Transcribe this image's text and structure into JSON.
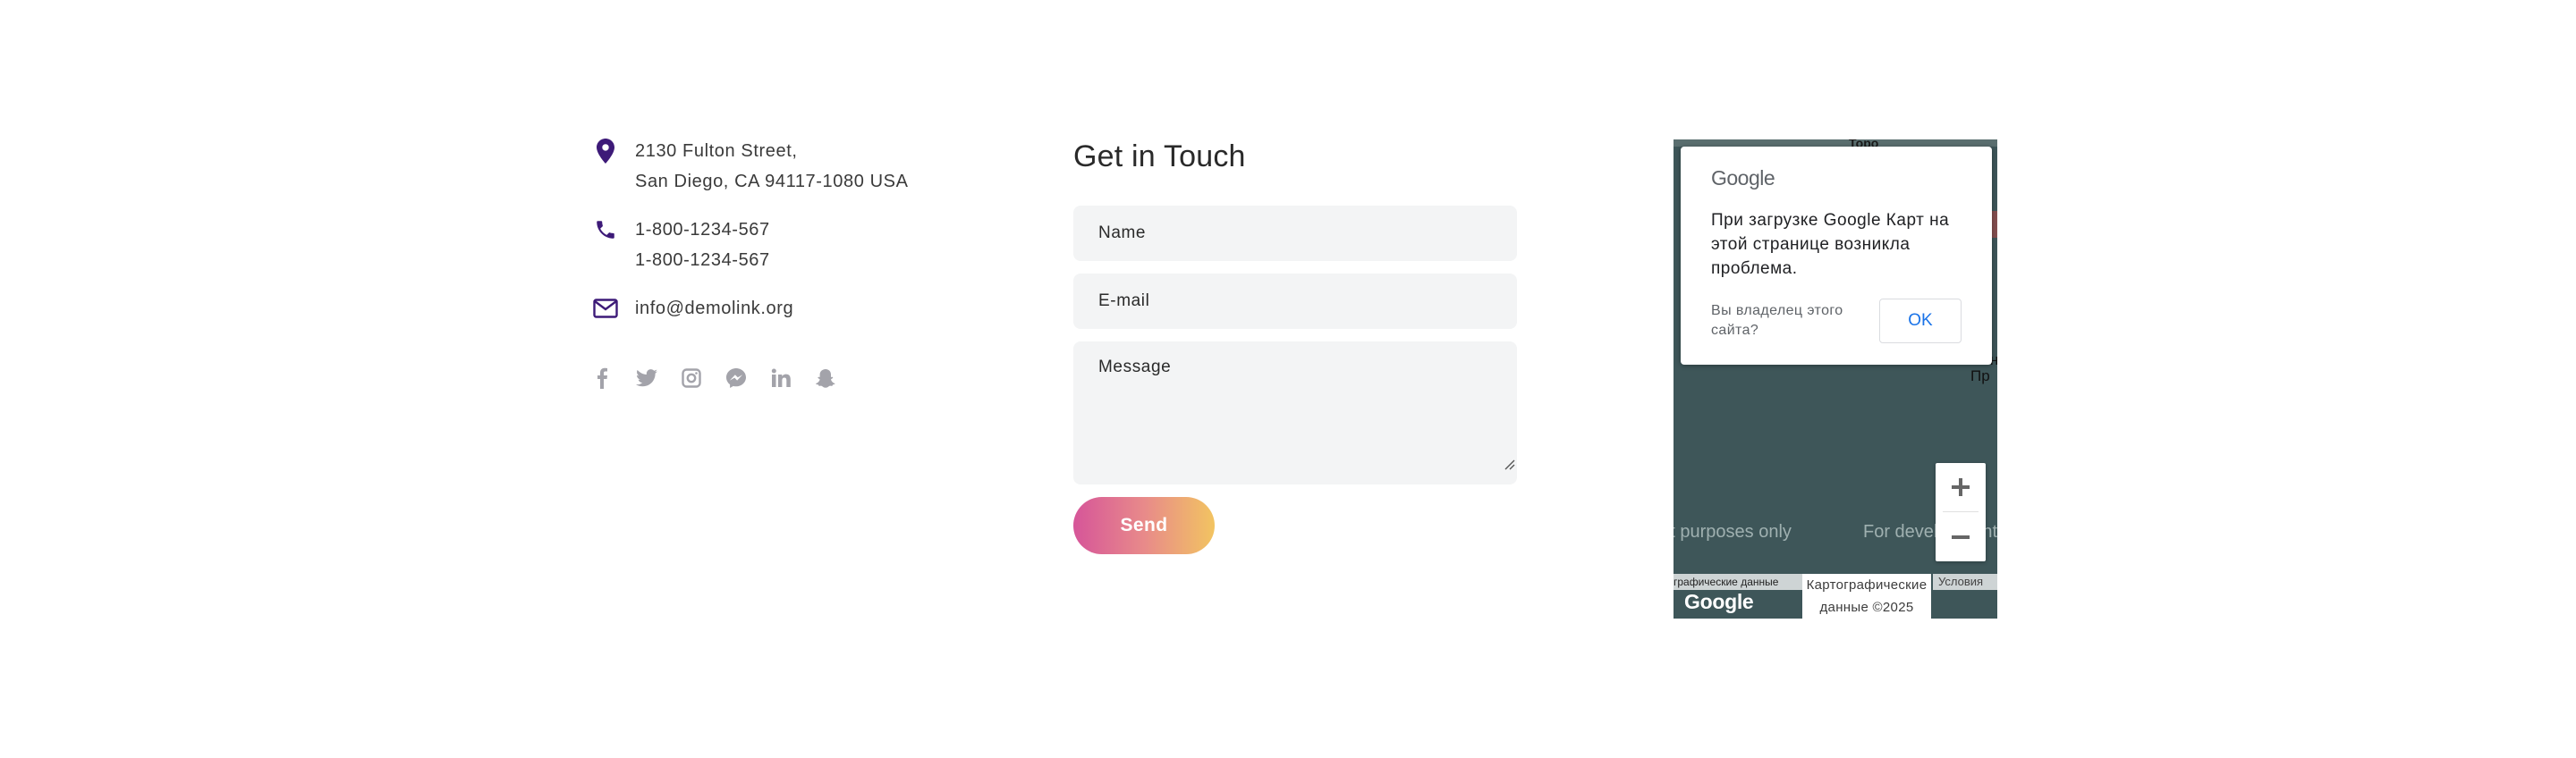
{
  "contact": {
    "address": {
      "icon": "map-pin-icon",
      "line1": "2130 Fulton Street,",
      "line2": "San Diego, CA 94117-1080 USA"
    },
    "phone": {
      "icon": "phone-icon",
      "line1": "1-800-1234-567",
      "line2": "1-800-1234-567"
    },
    "email": {
      "icon": "mail-icon",
      "value": "info@demolink.org"
    },
    "social": [
      "facebook-icon",
      "twitter-icon",
      "instagram-icon",
      "messenger-icon",
      "linkedin-icon",
      "snapchat-icon"
    ]
  },
  "form": {
    "title": "Get in Touch",
    "name_placeholder": "Name",
    "email_placeholder": "E-mail",
    "message_placeholder": "Message",
    "send_label": "Send"
  },
  "map": {
    "top_label": "Торо",
    "right_label": "Сан Пр",
    "dialog": {
      "logo": "Google",
      "message": "При загрузке Google Карт на этой странице возникла проблема.",
      "question": "Вы владелец этого сайта?",
      "ok_label": "OK"
    },
    "zoom_in": "+",
    "zoom_out": "−",
    "watermark_1": "ent purposes only",
    "watermark_2": "For development",
    "attrib_left": "графические данные",
    "attrib_mid": "Картографические данные ©2025",
    "terms": "Условия",
    "google_logo": "Google"
  },
  "colors": {
    "icon_accent": "#3d1a78",
    "social_gray": "#a3a3aa",
    "send_gradient_start": "#d65599",
    "send_gradient_end": "#f2c461",
    "map_bg": "#3e5659"
  }
}
